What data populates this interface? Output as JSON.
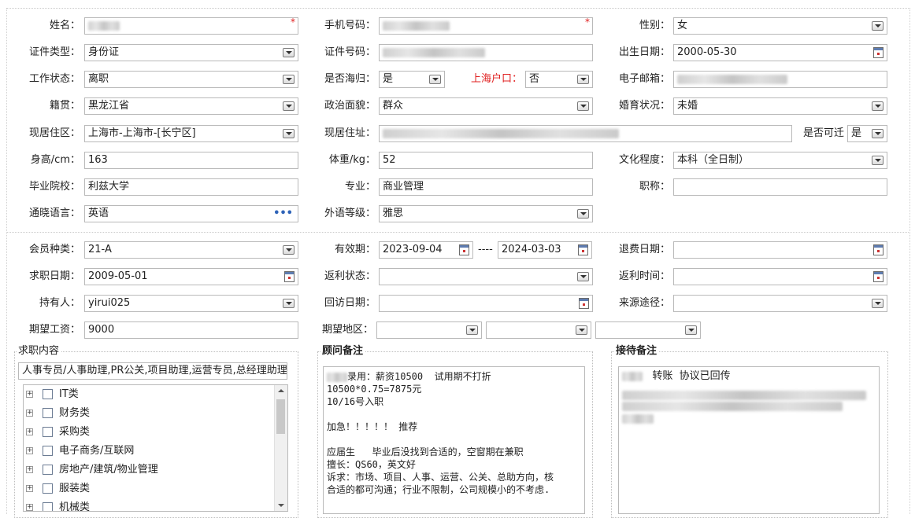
{
  "form": {
    "name": {
      "label": "姓名：",
      "value": ""
    },
    "phone": {
      "label": "手机号码：",
      "value": ""
    },
    "gender": {
      "label": "性别：",
      "value": "女"
    },
    "id_type": {
      "label": "证件类型：",
      "value": "身份证"
    },
    "id_number": {
      "label": "证件号码：",
      "value": ""
    },
    "birth_date": {
      "label": "出生日期：",
      "value": "2000-05-30"
    },
    "work_status": {
      "label": "工作状态：",
      "value": "离职"
    },
    "returnee": {
      "label": "是否海归：",
      "value": "是"
    },
    "shanghai_hukou": {
      "label": "上海户口：",
      "value": "否"
    },
    "email": {
      "label": "电子邮箱：",
      "value": ""
    },
    "native_place": {
      "label": "籍贯：",
      "value": "黑龙江省"
    },
    "political_status": {
      "label": "政治面貌：",
      "value": "群众"
    },
    "marital_status": {
      "label": "婚育状况：",
      "value": "未婚"
    },
    "residence_area": {
      "label": "现居住区：",
      "value": "上海市-上海市-[长宁区]"
    },
    "residence_address": {
      "label": "现居住址：",
      "value": ""
    },
    "relocatable": {
      "label": "是否可迁",
      "value": "是"
    },
    "height": {
      "label": "身高/cm：",
      "value": "163"
    },
    "weight": {
      "label": "体重/kg：",
      "value": "52"
    },
    "education": {
      "label": "文化程度：",
      "value": "本科（全日制）"
    },
    "school": {
      "label": "毕业院校：",
      "value": "利兹大学"
    },
    "major": {
      "label": "专业：",
      "value": "商业管理"
    },
    "title": {
      "label": "职称：",
      "value": ""
    },
    "language": {
      "label": "通晓语言：",
      "value": "英语"
    },
    "language_level": {
      "label": "外语等级：",
      "value": "雅思"
    }
  },
  "member": {
    "type": {
      "label": "会员种类：",
      "value": "21-A"
    },
    "validity": {
      "label": "有效期：",
      "from": "2023-09-04",
      "sep": "----",
      "to": "2024-03-03"
    },
    "refund_date": {
      "label": "退费日期：",
      "value": ""
    },
    "job_seek_date": {
      "label": "求职日期：",
      "value": "2009-05-01"
    },
    "rebate_status": {
      "label": "返利状态：",
      "value": ""
    },
    "rebate_time": {
      "label": "返利时间：",
      "value": ""
    },
    "holder": {
      "label": "持有人：",
      "value": "yirui025"
    },
    "revisit_date": {
      "label": "回访日期：",
      "value": ""
    },
    "source": {
      "label": "来源途径：",
      "value": ""
    },
    "expected_salary": {
      "label": "期望工资：",
      "value": "9000"
    },
    "expected_region": {
      "label": "期望地区：",
      "values": [
        "",
        "",
        ""
      ]
    }
  },
  "job_content": {
    "title": "求职内容",
    "summary": "人事专员/人事助理,PR公关,项目助理,运营专员,总经理助理",
    "tree": [
      {
        "label": "IT类"
      },
      {
        "label": "财务类"
      },
      {
        "label": "采购类"
      },
      {
        "label": "电子商务/互联网"
      },
      {
        "label": "房地产/建筑/物业管理"
      },
      {
        "label": "服装类"
      },
      {
        "label": "机械类"
      }
    ]
  },
  "advisor_notes": {
    "title": "顾问备注",
    "lines": [
      "录用：薪资10500  试用期不打折",
      "10500*0.75=7875元",
      "10/16号入职",
      "",
      "加急！！！！！ 推荐",
      "",
      "应届生   毕业后没找到合适的，空窗期在兼职",
      "擅长：QS60，英文好",
      "诉求：市场、项目、人事、运营、公关、总助方向，核",
      "合适的都可沟通；行业不限制，公司规模小的不考虑."
    ]
  },
  "reception_notes": {
    "title": "接待备注",
    "line1": "转账  协议已回传"
  },
  "colors": {
    "required": "#e02020",
    "border": "#b9b9b9",
    "accent": "#2e63b8"
  }
}
